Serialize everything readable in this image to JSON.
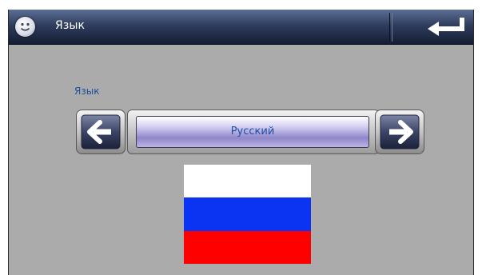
{
  "header": {
    "title": "Язык",
    "left_icon": "smiley-icon",
    "right_icon": "return-arrow-icon"
  },
  "main": {
    "label": "Язык",
    "selected_language": "Русский",
    "prev_icon": "arrow-left-icon",
    "next_icon": "arrow-right-icon",
    "flag_colors": [
      "#ffffff",
      "#0a34f2",
      "#ff0000"
    ]
  },
  "colors": {
    "background": "#ababab",
    "title_bar": "#2f3d5e",
    "label_text": "#1c4f9e",
    "selector_fill": "#a69ed8"
  }
}
